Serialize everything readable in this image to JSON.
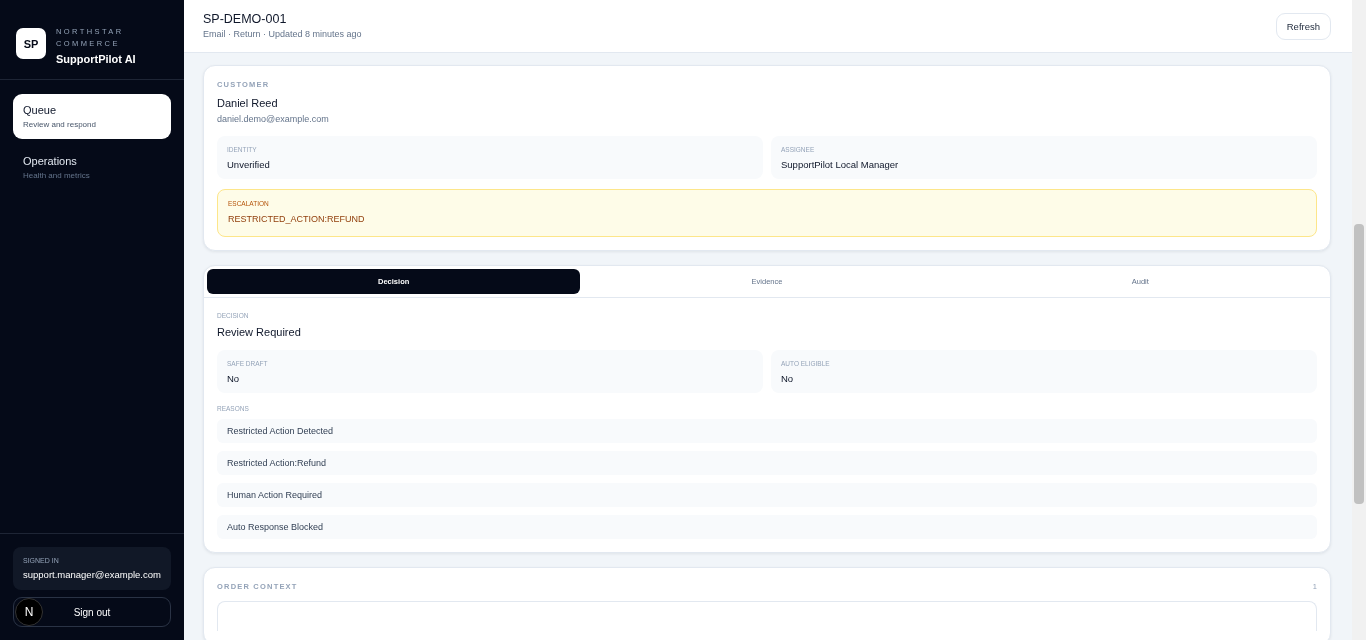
{
  "sidebar": {
    "brand": {
      "logo": "SP",
      "company": "NORTHSTAR COMMERCE",
      "product": "SupportPilot AI"
    },
    "nav": [
      {
        "title": "Queue",
        "subtitle": "Review and respond",
        "selected": true
      },
      {
        "title": "Operations",
        "subtitle": "Health and metrics",
        "selected": false
      }
    ],
    "signed_in": {
      "label": "SIGNED IN",
      "email": "support.manager@example.com"
    },
    "avatar": "N",
    "sign_out": "Sign out"
  },
  "header": {
    "title": "SP-DEMO-001",
    "subtitle": "Email · Return · Updated 8 minutes ago",
    "refresh": "Refresh"
  },
  "customer": {
    "label": "CUSTOMER",
    "name": "Daniel Reed",
    "email": "daniel.demo@example.com",
    "fields": [
      {
        "label": "IDENTITY",
        "value": "Unverified"
      },
      {
        "label": "ASSIGNEE",
        "value": "SupportPilot Local Manager"
      }
    ],
    "escalation": {
      "label": "ESCALATION",
      "value": "RESTRICTED_ACTION:REFUND"
    }
  },
  "tabs": [
    {
      "label": "Decision",
      "selected": true
    },
    {
      "label": "Evidence",
      "selected": false
    },
    {
      "label": "Audit",
      "selected": false
    }
  ],
  "decision": {
    "label": "DECISION",
    "value": "Review Required",
    "fields": [
      {
        "label": "SAFE DRAFT",
        "value": "No"
      },
      {
        "label": "AUTO ELIGIBLE",
        "value": "No"
      }
    ],
    "reasons_label": "REASONS",
    "reasons": [
      "Restricted Action Detected",
      "Restricted Action:Refund",
      "Human Action Required",
      "Auto Response Blocked"
    ]
  },
  "order_context": {
    "label": "ORDER CONTEXT",
    "count": "1"
  }
}
